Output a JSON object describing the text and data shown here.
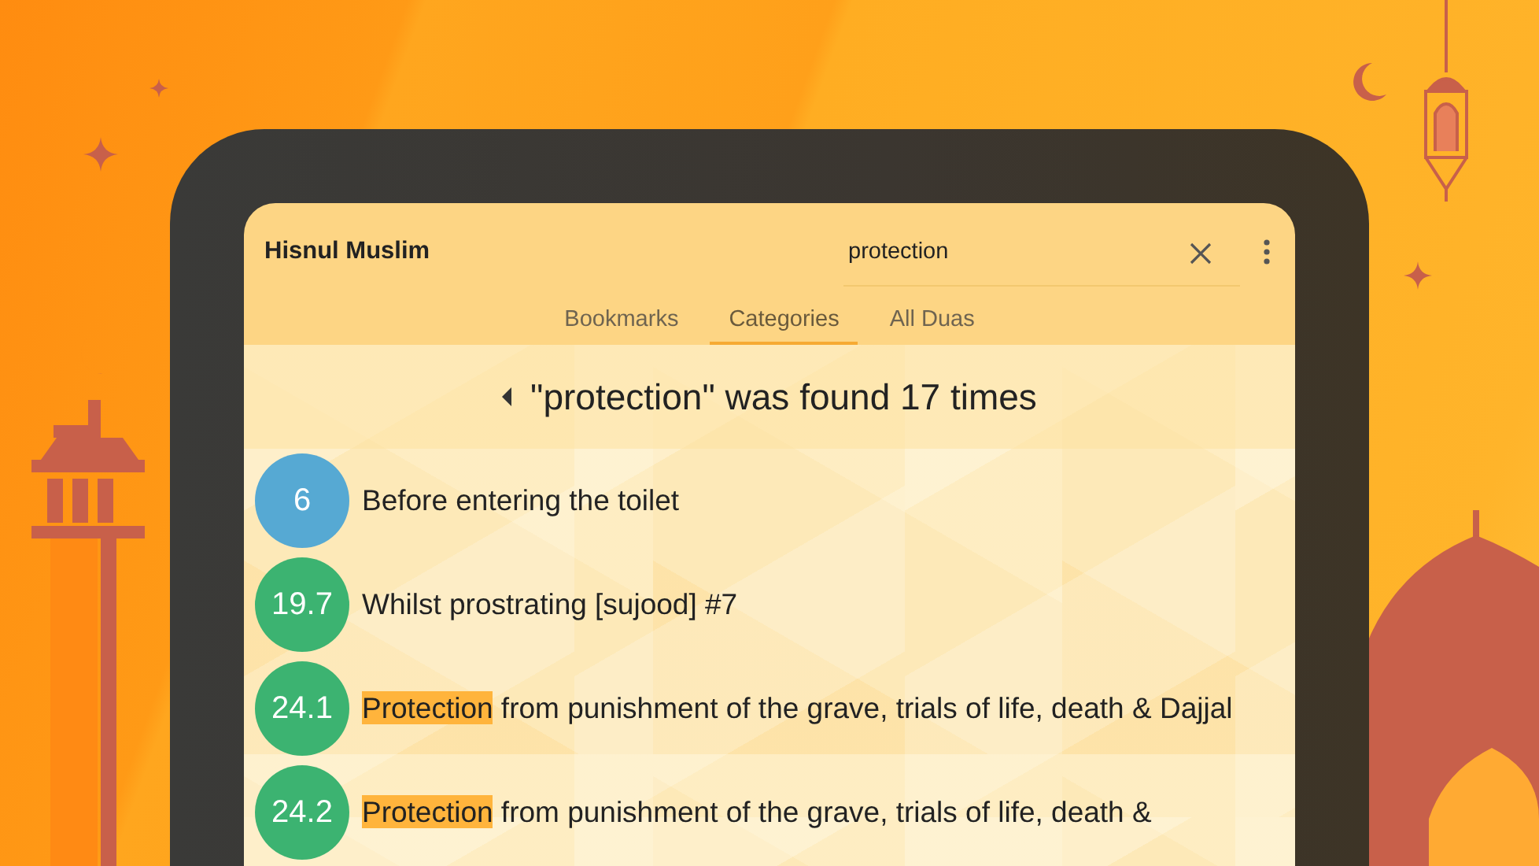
{
  "app_bar": {
    "title": "Hisnul Muslim",
    "search": {
      "value": "protection"
    }
  },
  "tabs": [
    {
      "label": "Bookmarks",
      "selected": false
    },
    {
      "label": "Categories",
      "selected": true
    },
    {
      "label": "All Duas",
      "selected": false
    }
  ],
  "results_header": "\"protection\" was found 17 times",
  "results": [
    {
      "number": "6",
      "color": "#56a9d3",
      "title_parts": [
        {
          "text": "Before entering the toilet",
          "highlighted": false
        }
      ]
    },
    {
      "number": "19.7",
      "color": "#3cb371",
      "title_parts": [
        {
          "text": "Whilst prostrating [sujood] #7",
          "highlighted": false
        }
      ]
    },
    {
      "number": "24.1",
      "color": "#3cb371",
      "title_parts": [
        {
          "text": "Protection",
          "highlighted": true
        },
        {
          "text": " from punishment of the grave, trials of life, death & Dajjal",
          "highlighted": false
        }
      ]
    },
    {
      "number": "24.2",
      "color": "#3cb371",
      "title_parts": [
        {
          "text": "Protection",
          "highlighted": true
        },
        {
          "text": " from punishment of the grave, trials of life, death &",
          "highlighted": false
        }
      ]
    }
  ]
}
